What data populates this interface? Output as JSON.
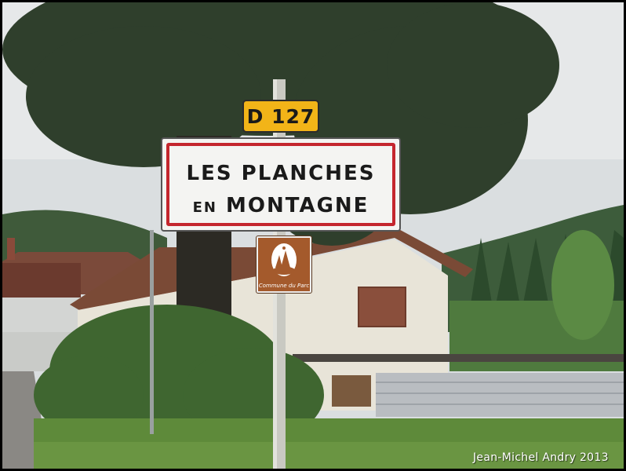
{
  "photo": {
    "subject": "roadside town entrance sign",
    "route_sign": {
      "label": "D 127",
      "color": "#f2b418"
    },
    "town_sign": {
      "line1": "LES PLANCHES",
      "line2_prefix": "EN",
      "line2_main": "MONTAGNE",
      "border_color": "#c4262e"
    },
    "park_sign": {
      "caption": "Commune du Parc",
      "color": "#a45a2c",
      "icon": "park-emblem-icon"
    },
    "watermark": "Jean-Michel  Andry 2013"
  }
}
